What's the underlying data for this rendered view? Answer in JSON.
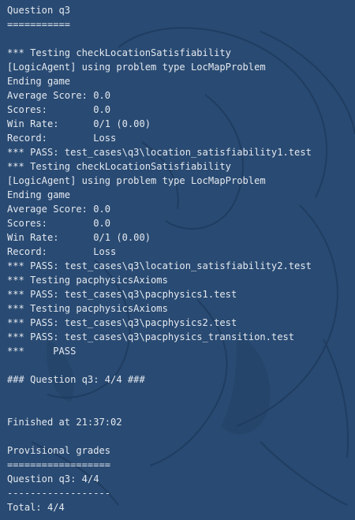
{
  "terminal": {
    "lines": [
      "Question q3",
      "===========",
      "",
      "*** Testing checkLocationSatisfiability",
      "[LogicAgent] using problem type LocMapProblem",
      "Ending game",
      "Average Score: 0.0",
      "Scores:        0.0",
      "Win Rate:      0/1 (0.00)",
      "Record:        Loss",
      "*** PASS: test_cases\\q3\\location_satisfiability1.test",
      "*** Testing checkLocationSatisfiability",
      "[LogicAgent] using problem type LocMapProblem",
      "Ending game",
      "Average Score: 0.0",
      "Scores:        0.0",
      "Win Rate:      0/1 (0.00)",
      "Record:        Loss",
      "*** PASS: test_cases\\q3\\location_satisfiability2.test",
      "*** Testing pacphysicsAxioms",
      "*** PASS: test_cases\\q3\\pacphysics1.test",
      "*** Testing pacphysicsAxioms",
      "*** PASS: test_cases\\q3\\pacphysics2.test",
      "*** PASS: test_cases\\q3\\pacphysics_transition.test",
      "***     PASS",
      "",
      "### Question q3: 4/4 ###",
      "",
      "",
      "Finished at 21:37:02",
      "",
      "Provisional grades",
      "==================",
      "Question q3: 4/4",
      "------------------",
      "Total: 4/4"
    ]
  }
}
